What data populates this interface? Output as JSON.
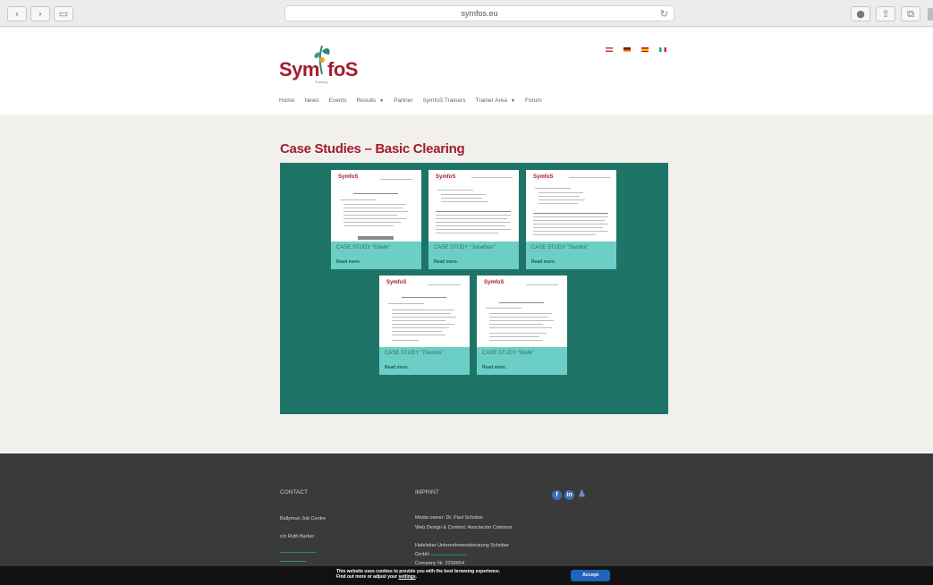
{
  "browser": {
    "url": "symfos.eu"
  },
  "header": {
    "logo_text_left": "Sym",
    "logo_text_right": "foS",
    "logo_subtitle": "Training",
    "menu": [
      {
        "label": "Home",
        "has_caret": false
      },
      {
        "label": "News",
        "has_caret": false
      },
      {
        "label": "Events",
        "has_caret": false
      },
      {
        "label": "Results",
        "has_caret": true
      },
      {
        "label": "Partner",
        "has_caret": false
      },
      {
        "label": "SymfoS Trainers",
        "has_caret": false
      },
      {
        "label": "Trainer Area",
        "has_caret": true
      },
      {
        "label": "Forum",
        "has_caret": false
      }
    ]
  },
  "main": {
    "page_title": "Case Studies – Basic Clearing",
    "cards": [
      {
        "title": "CASE STUDY \"Edwin\"",
        "more": "Read more."
      },
      {
        "title": "CASE STUDY \"Jonathan\"",
        "more": "Read more."
      },
      {
        "title": "CASE STUDY \"Sandra\"",
        "more": "Read more."
      },
      {
        "title": "CASE STUDY \"Thomas\"",
        "more": "Read more."
      },
      {
        "title": "CASE STUDY \"Malik\"",
        "more": "Read more."
      }
    ]
  },
  "footer": {
    "contact_heading": "CONTACT",
    "contact_line1": "Ballymun Job Centre",
    "contact_line2": "c/o Ruth Barker",
    "imprint_heading": "IMPRINT",
    "imprint_line1": "Media owner: Dr. Paul Schober",
    "imprint_line2": "Web Design & Content: Asociación Caminos",
    "imprint_line3": "Hafelekar Unternehmensberatung Schober",
    "imprint_line4": "GmbH",
    "imprint_line5": "Company Nr. 2258654",
    "social_icons": [
      "facebook-icon",
      "linkedin-icon",
      "person-icon"
    ]
  },
  "cookie_bar": {
    "line1": "This website uses cookies to provide you with the best browsing experience.",
    "line2_prefix": "Find out more or adjust your ",
    "line2_link": "settings",
    "accept_label": "Accept"
  }
}
